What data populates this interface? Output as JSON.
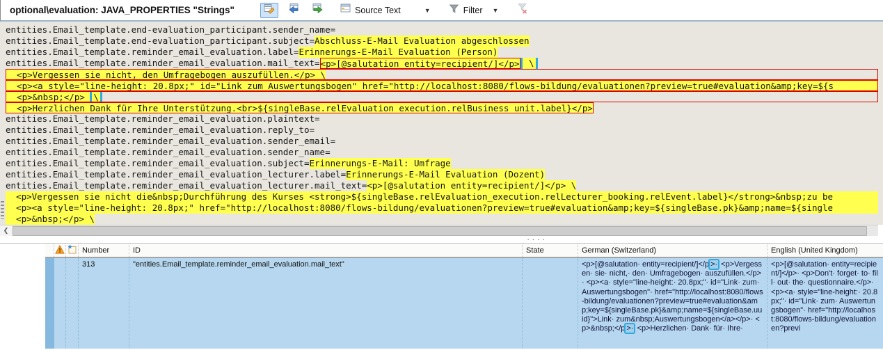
{
  "colors": {
    "accent_blue": "#2fa9de",
    "highlight_yellow": "#ffff4f",
    "segment_red": "#dd0000",
    "selected_row_blue": "#b6d7ef"
  },
  "toolbar": {
    "title": "optional\\evaluation: JAVA_PROPERTIES \"Strings\"",
    "source_text_label": "Source Text",
    "filter_label": "Filter"
  },
  "editor": {
    "lines": [
      {
        "segs": [
          {
            "c": "k",
            "t": "entities.Email_template.end-evaluation_participant.sender_name="
          }
        ]
      },
      {
        "segs": [
          {
            "c": "k",
            "t": "entities.Email_template.end-evaluation_participant.subject="
          },
          {
            "c": "y",
            "t": "Abschluss-E-Mail Evaluation abgeschlossen"
          }
        ]
      },
      {
        "segs": [
          {
            "c": "k",
            "t": "entities.Email_template.reminder_email_evaluation.label="
          },
          {
            "c": "y",
            "t": "Erinnerungs-E-Mail Evaluation (Person)"
          }
        ]
      },
      {
        "segs": [
          {
            "c": "k",
            "t": "entities.Email_template.reminder_email_evaluation.mail_text="
          },
          {
            "c": "yr",
            "t": "<p>[@salutation entity=recipient/]</p>"
          },
          {
            "c": "yb",
            "t": " \\"
          }
        ]
      },
      {
        "cls": "redbox",
        "segs": [
          {
            "c": "y",
            "t": "  <p>Vergessen sie nicht, den Umfragebogen auszufüllen.</p> \\"
          },
          {
            "c": "f",
            "t": ""
          }
        ]
      },
      {
        "cls": "redbox",
        "segs": [
          {
            "c": "yg",
            "t": "  <p><a style=\"line-height: 20.8px;\" id=\"Link zum Auswertungsbogen\" href=\"http://localhost:8080/flows-bildung/evaluationen?preview=true#evaluation&amp;key=${s"
          }
        ]
      },
      {
        "cls": "redbox",
        "segs": [
          {
            "c": "y",
            "t": "  <p>&nbsp;</p> "
          },
          {
            "c": "yb",
            "t": "\\"
          },
          {
            "c": "f",
            "t": ""
          }
        ]
      },
      {
        "segs": [
          {
            "c": "yr",
            "t": "  <p>Herzlichen Dank für Ihre Unterstützung.<br>${singleBase.relEvaluation execution.relBusiness unit.label}</p>"
          }
        ]
      },
      {
        "segs": [
          {
            "c": "k",
            "t": "entities.Email_template.reminder_email_evaluation.plaintext="
          }
        ]
      },
      {
        "segs": [
          {
            "c": "k",
            "t": "entities.Email_template.reminder_email_evaluation.reply_to="
          }
        ]
      },
      {
        "segs": [
          {
            "c": "k",
            "t": "entities.Email_template.reminder_email_evaluation.sender_email="
          }
        ]
      },
      {
        "segs": [
          {
            "c": "k",
            "t": "entities.Email_template.reminder_email_evaluation.sender_name="
          }
        ]
      },
      {
        "segs": [
          {
            "c": "k",
            "t": "entities.Email_template.reminder_email_evaluation.subject="
          },
          {
            "c": "y",
            "t": "Erinnerungs-E-Mail: Umfrage"
          }
        ]
      },
      {
        "segs": [
          {
            "c": "k",
            "t": "entities.Email_template.reminder_email_evaluation_lecturer.label="
          },
          {
            "c": "y",
            "t": "Erinnerungs-E-Mail Evaluation (Dozent)"
          }
        ]
      },
      {
        "segs": [
          {
            "c": "k",
            "t": "entities.Email_template.reminder_email_evaluation_lecturer.mail_text="
          },
          {
            "c": "y",
            "t": "<p>[@salutation entity=recipient/]</p> \\"
          }
        ]
      },
      {
        "segs": [
          {
            "c": "yg",
            "t": "  <p>Vergessen sie nicht die&nbsp;Durchführung des Kurses <strong>${singleBase.relEvaluation_execution.relLecturer_booking.relEvent.label}</strong>&nbsp;zu be"
          }
        ]
      },
      {
        "segs": [
          {
            "c": "yg",
            "t": "  <p><a style=\"line-height: 20.8px;\" href=\"http://localhost:8080/flows-bildung/evaluationen?preview=true#evaluation&amp;key=${singleBase.pk}&amp;name=${single"
          }
        ]
      },
      {
        "segs": [
          {
            "c": "y",
            "t": "  <p>&nbsp;</p> \\"
          }
        ]
      }
    ]
  },
  "grid": {
    "headers": {
      "number": "Number",
      "id": "ID",
      "state": "State",
      "german": "German (Switzerland)",
      "english": "English (United Kingdom)"
    },
    "row": {
      "number": "313",
      "id": "\"entities.Email_template.reminder_email_evaluation.mail_text\"",
      "state": "",
      "german_parts": [
        {
          "t": "<p>[@salutation· entity=recipient/]</p"
        },
        {
          "t": ">·",
          "hl": true
        },
        {
          "t": " <p>Vergessen· sie· nicht,· den· Umfragebogen· auszufüllen.</p>· <p><a· style=\"line-height:· 20.8px;\"· id=\"Link· zum· Auswertungsbogen\"· href=\"http://localhost:8080/flows-bildung/evaluationen?preview=true#evaluation&amp;key=${singleBase.pk}&amp;name=${singleBase.uuid}\">Link· zum&nbsp;Auswertungsbogen</a></p>· <p>&nbsp;</p"
        },
        {
          "t": ">·",
          "hl": true
        },
        {
          "t": " <p>Herzlichen· Dank· für· Ihre·"
        }
      ],
      "english_parts": [
        {
          "t": "<p>[@salutation· entity=recipient/]</p>· <p>Don't· forget· to· fill· out· the· questionnaire.</p>· <p><a· style=\"line-height:· 20.8px;\"· id=\"Link· zum· Auswertungsbogen\"· href=\"http://localhost:8080/flows-bildung/evaluationen?previ"
        }
      ]
    }
  }
}
